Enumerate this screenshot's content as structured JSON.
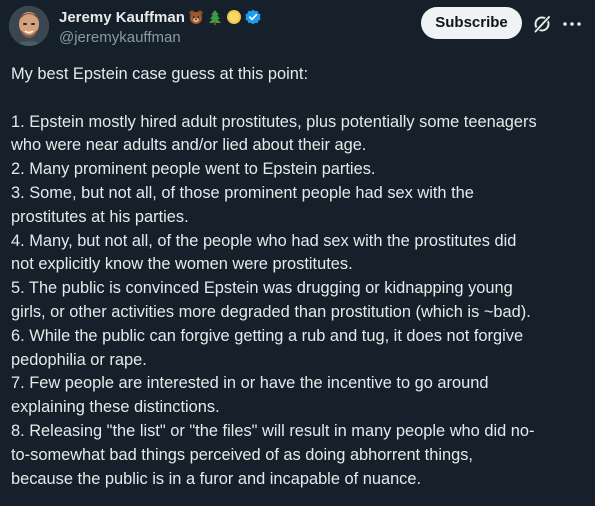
{
  "author": {
    "display_name": "Jeremy Kauffman",
    "handle": "@jeremykauffman",
    "badges": [
      "bear-face-emoji",
      "evergreen-tree-emoji",
      "coin-emoji",
      "verified-badge-icon"
    ]
  },
  "actions": {
    "subscribe_label": "Subscribe",
    "grok_icon": "grok-icon",
    "more_icon": "more-options-icon"
  },
  "post": {
    "lines": [
      "My best Epstein case guess at this point:",
      "",
      "1. Epstein mostly hired adult prostitutes, plus potentially some teenagers",
      "who were near adults and/or lied about their age.",
      "2. Many prominent people went to Epstein parties.",
      "3. Some, but not all, of those prominent people had sex with the",
      "prostitutes at his parties.",
      "4. Many, but not all, of the people who had sex with the prostitutes did",
      "not explicitly know the women were prostitutes.",
      "5. The public is convinced Epstein was drugging or kidnapping young",
      "girls, or other activities more degraded than prostitution (which is ~bad).",
      "6. While the public can forgive getting a rub and tug, it does not forgive",
      "pedophilia or rape.",
      "7. Few people are interested in or have the incentive to go around",
      "explaining these distinctions.",
      "8. Releasing \"the list\" or \"the files\" will result in many people who did no-",
      "to-somewhat bad things perceived of as doing abhorrent things,",
      "because the public is in a furor and incapable of nuance."
    ]
  },
  "colors": {
    "background": "#15202b",
    "text": "#e7e9ea",
    "secondary_text": "#8b98a5",
    "verified": "#1d9bf0",
    "button_bg": "#eff3f4"
  }
}
